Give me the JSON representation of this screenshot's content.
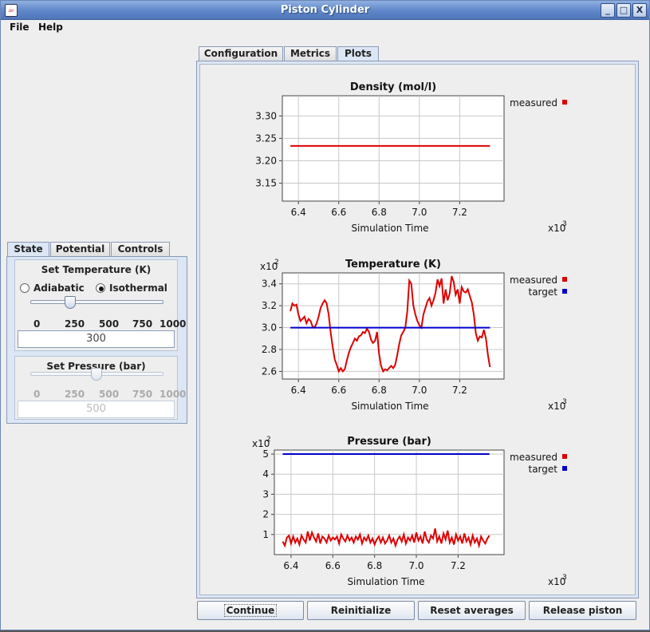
{
  "window": {
    "title": "Piston Cylinder",
    "minimize": "_",
    "maximize": "□",
    "close": "X",
    "icon": "java-icon"
  },
  "menu": {
    "file": "File",
    "help": "Help"
  },
  "left_tabs": [
    "State",
    "Potential",
    "Controls"
  ],
  "temperature": {
    "title": "Set Temperature (K)",
    "adiabatic": "Adiabatic",
    "isothermal": "Isothermal",
    "selected": "Isothermal",
    "slider_min": 0,
    "slider_max": 1000,
    "slider_value": 300,
    "ticks": [
      "0",
      "250",
      "500",
      "750",
      "1000"
    ],
    "value": "300"
  },
  "pressure": {
    "title": "Set Pressure (bar)",
    "slider_min": 0,
    "slider_max": 1000,
    "slider_value": 500,
    "ticks": [
      "0",
      "250",
      "500",
      "750",
      "1000"
    ],
    "value": "500",
    "enabled": false
  },
  "right_tabs": [
    "Configuration",
    "Metrics",
    "Plots"
  ],
  "active_right_tab": "Plots",
  "buttons": {
    "continue": "Continue",
    "reinitialize": "Reinitialize",
    "reset_averages": "Reset averages",
    "release_piston": "Release piston"
  },
  "colors": {
    "measured": "#dd0000",
    "target": "#0000cc",
    "accent": "#dce6f4"
  },
  "chart_data": [
    {
      "type": "line",
      "title": "Density (mol/l)",
      "xlabel": "Simulation Time",
      "x_multiplier": "x10",
      "x_multiplier_exp": "3",
      "y_multiplier": "",
      "y_multiplier_exp": "",
      "xlim": [
        6.32,
        7.42
      ],
      "ylim": [
        3.11,
        3.345
      ],
      "xticks": [
        "6.4",
        "6.6",
        "6.8",
        "7.0",
        "7.2"
      ],
      "yticks": [
        "3.15",
        "3.20",
        "3.25",
        "3.30"
      ],
      "grid": true,
      "legend": "top-right",
      "series": [
        {
          "name": "measured",
          "color": "#dd0000",
          "x": [
            6.36,
            7.35
          ],
          "values": [
            3.233,
            3.233
          ]
        }
      ]
    },
    {
      "type": "line",
      "title": "Temperature (K)",
      "xlabel": "Simulation Time",
      "x_multiplier": "x10",
      "x_multiplier_exp": "3",
      "y_multiplier": "x10",
      "y_multiplier_exp": "2",
      "xlim": [
        6.32,
        7.42
      ],
      "ylim": [
        2.53,
        3.5
      ],
      "xticks": [
        "6.4",
        "6.6",
        "6.8",
        "7.0",
        "7.2"
      ],
      "yticks": [
        "2.6",
        "2.8",
        "3.0",
        "3.2",
        "3.4"
      ],
      "grid": true,
      "legend": "top-right",
      "series": [
        {
          "name": "measured",
          "color": "#dd0000",
          "x": [
            6.36,
            6.37,
            6.38,
            6.39,
            6.4,
            6.41,
            6.42,
            6.43,
            6.44,
            6.45,
            6.46,
            6.47,
            6.48,
            6.49,
            6.5,
            6.51,
            6.52,
            6.53,
            6.54,
            6.55,
            6.56,
            6.57,
            6.58,
            6.59,
            6.6,
            6.61,
            6.62,
            6.63,
            6.64,
            6.65,
            6.66,
            6.67,
            6.68,
            6.69,
            6.7,
            6.71,
            6.72,
            6.73,
            6.74,
            6.75,
            6.76,
            6.77,
            6.78,
            6.79,
            6.8,
            6.81,
            6.82,
            6.83,
            6.84,
            6.85,
            6.86,
            6.87,
            6.88,
            6.89,
            6.9,
            6.91,
            6.92,
            6.93,
            6.94,
            6.95,
            6.96,
            6.97,
            6.98,
            6.99,
            7.0,
            7.01,
            7.02,
            7.03,
            7.04,
            7.05,
            7.06,
            7.07,
            7.08,
            7.09,
            7.1,
            7.11,
            7.12,
            7.13,
            7.14,
            7.15,
            7.16,
            7.17,
            7.18,
            7.19,
            7.2,
            7.21,
            7.22,
            7.23,
            7.24,
            7.25,
            7.26,
            7.27,
            7.28,
            7.29,
            7.3,
            7.31,
            7.32,
            7.33,
            7.34,
            7.35
          ],
          "values": [
            3.15,
            3.22,
            3.2,
            3.21,
            3.12,
            3.06,
            3.08,
            3.1,
            3.04,
            3.08,
            3.06,
            3.01,
            3.0,
            3.04,
            3.1,
            3.18,
            3.22,
            3.25,
            3.22,
            3.12,
            2.95,
            2.82,
            2.71,
            2.66,
            2.6,
            2.63,
            2.6,
            2.62,
            2.7,
            2.77,
            2.82,
            2.86,
            2.9,
            2.88,
            2.92,
            2.93,
            2.96,
            2.95,
            2.99,
            2.96,
            2.89,
            2.86,
            2.88,
            2.96,
            2.76,
            2.65,
            2.6,
            2.62,
            2.61,
            2.63,
            2.65,
            2.63,
            2.66,
            2.75,
            2.85,
            2.93,
            2.96,
            3.0,
            3.15,
            3.43,
            3.4,
            3.2,
            3.12,
            3.06,
            3.02,
            3.0,
            3.12,
            3.18,
            3.24,
            3.27,
            3.2,
            3.25,
            3.32,
            3.44,
            3.38,
            3.45,
            3.22,
            3.35,
            3.25,
            3.31,
            3.47,
            3.42,
            3.3,
            3.35,
            3.22,
            3.37,
            3.33,
            3.32,
            3.35,
            3.29,
            3.23,
            3.12,
            2.95,
            2.88,
            2.92,
            2.91,
            2.98,
            2.9,
            2.75,
            2.64
          ],
          "note": ""
        },
        {
          "name": "target",
          "color": "#0000cc",
          "x": [
            6.36,
            7.35
          ],
          "values": [
            3.0,
            3.0
          ]
        }
      ]
    },
    {
      "type": "line",
      "title": "Pressure (bar)",
      "xlabel": "Simulation Time",
      "x_multiplier": "x10",
      "x_multiplier_exp": "3",
      "y_multiplier": "x10",
      "y_multiplier_exp": "2",
      "xlim": [
        6.32,
        7.42
      ],
      "ylim": [
        0.0,
        5.2
      ],
      "xticks": [
        "6.4",
        "6.6",
        "6.8",
        "7.0",
        "7.2"
      ],
      "yticks": [
        "1",
        "2",
        "3",
        "4",
        "5"
      ],
      "grid": true,
      "legend": "top-right",
      "series": [
        {
          "name": "measured",
          "color": "#dd0000",
          "x": [
            6.36,
            6.37,
            6.38,
            6.39,
            6.4,
            6.41,
            6.42,
            6.43,
            6.44,
            6.45,
            6.46,
            6.47,
            6.48,
            6.49,
            6.5,
            6.51,
            6.52,
            6.53,
            6.54,
            6.55,
            6.56,
            6.57,
            6.58,
            6.59,
            6.6,
            6.61,
            6.62,
            6.63,
            6.64,
            6.65,
            6.66,
            6.67,
            6.68,
            6.69,
            6.7,
            6.71,
            6.72,
            6.73,
            6.74,
            6.75,
            6.76,
            6.77,
            6.78,
            6.79,
            6.8,
            6.81,
            6.82,
            6.83,
            6.84,
            6.85,
            6.86,
            6.87,
            6.88,
            6.89,
            6.9,
            6.91,
            6.92,
            6.93,
            6.94,
            6.95,
            6.96,
            6.97,
            6.98,
            6.99,
            7.0,
            7.01,
            7.02,
            7.03,
            7.04,
            7.05,
            7.06,
            7.07,
            7.08,
            7.09,
            7.1,
            7.11,
            7.12,
            7.13,
            7.14,
            7.15,
            7.16,
            7.17,
            7.18,
            7.19,
            7.2,
            7.21,
            7.22,
            7.23,
            7.24,
            7.25,
            7.26,
            7.27,
            7.28,
            7.29,
            7.3,
            7.31,
            7.32,
            7.33,
            7.34,
            7.35
          ],
          "values": [
            0.65,
            0.45,
            0.85,
            0.95,
            0.55,
            0.9,
            0.6,
            0.8,
            0.5,
            0.95,
            0.75,
            0.6,
            1.15,
            0.7,
            1.1,
            0.85,
            0.65,
            1.05,
            0.55,
            0.9,
            0.8,
            0.6,
            0.95,
            0.7,
            0.85,
            0.75,
            0.9,
            0.55,
            1.0,
            0.8,
            0.65,
            0.95,
            0.7,
            0.85,
            0.6,
            0.9,
            0.75,
            1.0,
            0.55,
            0.85,
            0.7,
            0.95,
            0.6,
            0.8,
            0.5,
            0.75,
            0.9,
            0.6,
            0.85,
            0.55,
            0.7,
            0.95,
            0.6,
            0.8,
            0.45,
            0.75,
            0.9,
            0.65,
            1.0,
            0.55,
            0.85,
            0.7,
            0.95,
            0.6,
            1.1,
            0.7,
            0.9,
            0.55,
            1.15,
            0.75,
            0.6,
            0.95,
            0.8,
            1.3,
            0.65,
            0.9,
            0.55,
            1.05,
            0.75,
            1.2,
            0.6,
            0.85,
            0.5,
            1.0,
            0.7,
            0.9,
            0.55,
            1.05,
            0.65,
            0.85,
            0.5,
            0.95,
            0.6,
            0.8,
            0.45,
            0.9,
            0.7,
            0.55,
            0.8,
            0.95
          ]
        },
        {
          "name": "target",
          "color": "#0000cc",
          "x": [
            6.36,
            7.35
          ],
          "values": [
            5.0,
            5.0
          ]
        }
      ]
    }
  ]
}
